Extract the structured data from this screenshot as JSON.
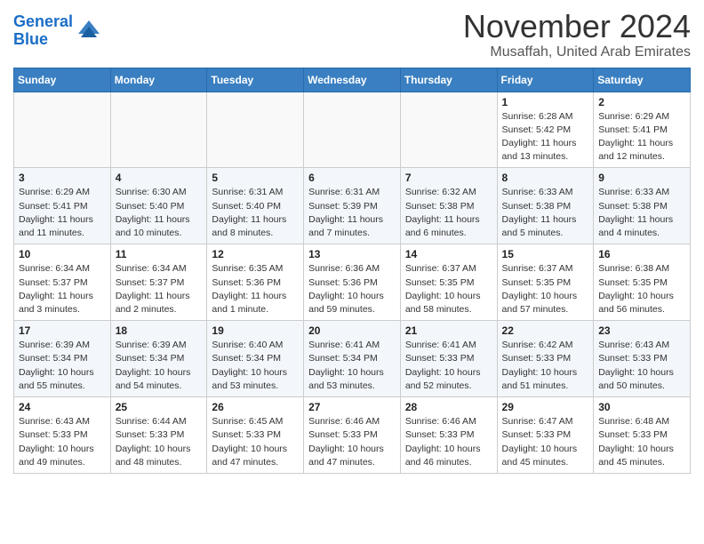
{
  "header": {
    "logo_line1": "General",
    "logo_line2": "Blue",
    "month": "November 2024",
    "location": "Musaffah, United Arab Emirates"
  },
  "weekdays": [
    "Sunday",
    "Monday",
    "Tuesday",
    "Wednesday",
    "Thursday",
    "Friday",
    "Saturday"
  ],
  "weeks": [
    [
      {
        "day": "",
        "info": ""
      },
      {
        "day": "",
        "info": ""
      },
      {
        "day": "",
        "info": ""
      },
      {
        "day": "",
        "info": ""
      },
      {
        "day": "",
        "info": ""
      },
      {
        "day": "1",
        "info": "Sunrise: 6:28 AM\nSunset: 5:42 PM\nDaylight: 11 hours\nand 13 minutes."
      },
      {
        "day": "2",
        "info": "Sunrise: 6:29 AM\nSunset: 5:41 PM\nDaylight: 11 hours\nand 12 minutes."
      }
    ],
    [
      {
        "day": "3",
        "info": "Sunrise: 6:29 AM\nSunset: 5:41 PM\nDaylight: 11 hours\nand 11 minutes."
      },
      {
        "day": "4",
        "info": "Sunrise: 6:30 AM\nSunset: 5:40 PM\nDaylight: 11 hours\nand 10 minutes."
      },
      {
        "day": "5",
        "info": "Sunrise: 6:31 AM\nSunset: 5:40 PM\nDaylight: 11 hours\nand 8 minutes."
      },
      {
        "day": "6",
        "info": "Sunrise: 6:31 AM\nSunset: 5:39 PM\nDaylight: 11 hours\nand 7 minutes."
      },
      {
        "day": "7",
        "info": "Sunrise: 6:32 AM\nSunset: 5:38 PM\nDaylight: 11 hours\nand 6 minutes."
      },
      {
        "day": "8",
        "info": "Sunrise: 6:33 AM\nSunset: 5:38 PM\nDaylight: 11 hours\nand 5 minutes."
      },
      {
        "day": "9",
        "info": "Sunrise: 6:33 AM\nSunset: 5:38 PM\nDaylight: 11 hours\nand 4 minutes."
      }
    ],
    [
      {
        "day": "10",
        "info": "Sunrise: 6:34 AM\nSunset: 5:37 PM\nDaylight: 11 hours\nand 3 minutes."
      },
      {
        "day": "11",
        "info": "Sunrise: 6:34 AM\nSunset: 5:37 PM\nDaylight: 11 hours\nand 2 minutes."
      },
      {
        "day": "12",
        "info": "Sunrise: 6:35 AM\nSunset: 5:36 PM\nDaylight: 11 hours\nand 1 minute."
      },
      {
        "day": "13",
        "info": "Sunrise: 6:36 AM\nSunset: 5:36 PM\nDaylight: 10 hours\nand 59 minutes."
      },
      {
        "day": "14",
        "info": "Sunrise: 6:37 AM\nSunset: 5:35 PM\nDaylight: 10 hours\nand 58 minutes."
      },
      {
        "day": "15",
        "info": "Sunrise: 6:37 AM\nSunset: 5:35 PM\nDaylight: 10 hours\nand 57 minutes."
      },
      {
        "day": "16",
        "info": "Sunrise: 6:38 AM\nSunset: 5:35 PM\nDaylight: 10 hours\nand 56 minutes."
      }
    ],
    [
      {
        "day": "17",
        "info": "Sunrise: 6:39 AM\nSunset: 5:34 PM\nDaylight: 10 hours\nand 55 minutes."
      },
      {
        "day": "18",
        "info": "Sunrise: 6:39 AM\nSunset: 5:34 PM\nDaylight: 10 hours\nand 54 minutes."
      },
      {
        "day": "19",
        "info": "Sunrise: 6:40 AM\nSunset: 5:34 PM\nDaylight: 10 hours\nand 53 minutes."
      },
      {
        "day": "20",
        "info": "Sunrise: 6:41 AM\nSunset: 5:34 PM\nDaylight: 10 hours\nand 53 minutes."
      },
      {
        "day": "21",
        "info": "Sunrise: 6:41 AM\nSunset: 5:33 PM\nDaylight: 10 hours\nand 52 minutes."
      },
      {
        "day": "22",
        "info": "Sunrise: 6:42 AM\nSunset: 5:33 PM\nDaylight: 10 hours\nand 51 minutes."
      },
      {
        "day": "23",
        "info": "Sunrise: 6:43 AM\nSunset: 5:33 PM\nDaylight: 10 hours\nand 50 minutes."
      }
    ],
    [
      {
        "day": "24",
        "info": "Sunrise: 6:43 AM\nSunset: 5:33 PM\nDaylight: 10 hours\nand 49 minutes."
      },
      {
        "day": "25",
        "info": "Sunrise: 6:44 AM\nSunset: 5:33 PM\nDaylight: 10 hours\nand 48 minutes."
      },
      {
        "day": "26",
        "info": "Sunrise: 6:45 AM\nSunset: 5:33 PM\nDaylight: 10 hours\nand 47 minutes."
      },
      {
        "day": "27",
        "info": "Sunrise: 6:46 AM\nSunset: 5:33 PM\nDaylight: 10 hours\nand 47 minutes."
      },
      {
        "day": "28",
        "info": "Sunrise: 6:46 AM\nSunset: 5:33 PM\nDaylight: 10 hours\nand 46 minutes."
      },
      {
        "day": "29",
        "info": "Sunrise: 6:47 AM\nSunset: 5:33 PM\nDaylight: 10 hours\nand 45 minutes."
      },
      {
        "day": "30",
        "info": "Sunrise: 6:48 AM\nSunset: 5:33 PM\nDaylight: 10 hours\nand 45 minutes."
      }
    ]
  ]
}
